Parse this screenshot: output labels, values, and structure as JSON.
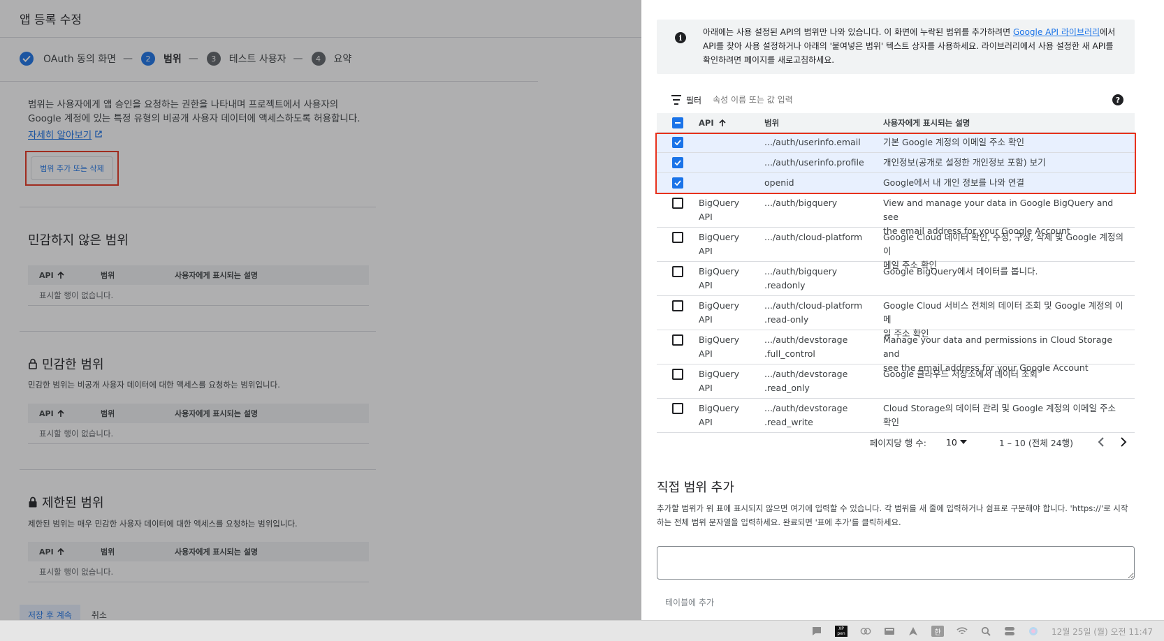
{
  "left": {
    "page_title": "앱 등록 수정",
    "stepper": [
      {
        "label": "OAuth 동의 화면",
        "state": "done"
      },
      {
        "num": "2",
        "label": "범위",
        "state": "active"
      },
      {
        "num": "3",
        "label": "테스트 사용자",
        "state": "pending"
      },
      {
        "num": "4",
        "label": "요약",
        "state": "pending"
      }
    ],
    "step_separator": "—",
    "intro_line1": "범위는 사용자에게 앱 승인을 요청하는 권한을 나타내며 프로젝트에서 사용자의",
    "intro_line2": "Google 계정에 있는 특정 유형의 비공개 사용자 데이터에 액세스하도록 허용합니다.",
    "learn_more": "자세히 알아보기",
    "scope_button": "범위 추가 또는 삭제",
    "table_headers": {
      "api": "API",
      "scope": "범위",
      "desc": "사용자에게 표시되는 설명"
    },
    "empty_text": "표시할 행이 없습니다.",
    "sections": {
      "nonsensitive": {
        "title": "민감하지 않은 범위"
      },
      "sensitive": {
        "title": "민감한 범위",
        "desc": "민감한 범위는 비공개 사용자 데이터에 대한 액세스를 요청하는 범위입니다."
      },
      "restricted": {
        "title": "제한된 범위",
        "desc": "제한된 범위는 매우 민감한 사용자 데이터에 대한 액세스를 요청하는 범위입니다."
      }
    },
    "save_button": "저장 후 계속",
    "cancel_button": "취소"
  },
  "panel": {
    "info_text_before": "아래에는 사용 설정된 API의 범위만 나와 있습니다. 이 화면에 누락된 범위를 추가하려면 ",
    "info_link": "Google API 라이브러리",
    "info_text_after": "에서 API를 찾아 사용 설정하거나 아래의 '붙여넣은 범위' 텍스트 상자를 사용하세요. 라이브러리에서 사용 설정한 새 API를 확인하려면 페이지를 새로고침하세요.",
    "filter_label": "필터",
    "filter_placeholder": "속성 이름 또는 값 입력",
    "headers": {
      "api": "API",
      "scope": "범위",
      "desc": "사용자에게 표시되는 설명"
    },
    "rows": [
      {
        "checked": true,
        "api1": "",
        "api2": "",
        "scope1": ".../auth/userinfo.email",
        "scope2": "",
        "desc1": "기본 Google 계정의 이메일 주소 확인",
        "desc2": ""
      },
      {
        "checked": true,
        "api1": "",
        "api2": "",
        "scope1": ".../auth/userinfo.profile",
        "scope2": "",
        "desc1": "개인정보(공개로 설정한 개인정보 포함) 보기",
        "desc2": ""
      },
      {
        "checked": true,
        "api1": "",
        "api2": "",
        "scope1": "openid",
        "scope2": "",
        "desc1": "Google에서 내 개인 정보를 나와 연결",
        "desc2": ""
      },
      {
        "checked": false,
        "api1": "BigQuery",
        "api2": "API",
        "scope1": ".../auth/bigquery",
        "scope2": "",
        "desc1": "View and manage your data in Google BigQuery and see",
        "desc2": "the email address for your Google Account"
      },
      {
        "checked": false,
        "api1": "BigQuery",
        "api2": "API",
        "scope1": ".../auth/cloud-platform",
        "scope2": "",
        "desc1": "Google Cloud 데이터 확인, 수정, 구성, 삭제 및 Google 계정의 이",
        "desc2": "메일 주소 확인"
      },
      {
        "checked": false,
        "api1": "BigQuery",
        "api2": "API",
        "scope1": ".../auth/bigquery",
        "scope2": ".readonly",
        "desc1": "Google BigQuery에서 데이터를 봅니다.",
        "desc2": ""
      },
      {
        "checked": false,
        "api1": "BigQuery",
        "api2": "API",
        "scope1": ".../auth/cloud-platform",
        "scope2": ".read-only",
        "desc1": "Google Cloud 서비스 전체의 데이터 조회 및 Google 계정의 이메",
        "desc2": "일 주소 확인"
      },
      {
        "checked": false,
        "api1": "BigQuery",
        "api2": "API",
        "scope1": ".../auth/devstorage",
        "scope2": ".full_control",
        "desc1": "Manage your data and permissions in Cloud Storage and",
        "desc2": "see the email address for your Google Account"
      },
      {
        "checked": false,
        "api1": "BigQuery",
        "api2": "API",
        "scope1": ".../auth/devstorage",
        "scope2": ".read_only",
        "desc1": "Google 클라우드 저장소에서 데이터 조회",
        "desc2": ""
      },
      {
        "checked": false,
        "api1": "BigQuery",
        "api2": "API",
        "scope1": ".../auth/devstorage",
        "scope2": ".read_write",
        "desc1": "Cloud Storage의 데이터 관리 및 Google 계정의 이메일 주소 확인",
        "desc2": ""
      }
    ],
    "pager": {
      "rows_per_page_label": "페이지당 행 수:",
      "rows_per_page": "10",
      "range": "1 – 10 (전체 24행)"
    },
    "manual_title": "직접 범위 추가",
    "manual_desc": "추가할 범위가 위 표에 표시되지 않으면 여기에 입력할 수 있습니다. 각 범위를 새 줄에 입력하거나 쉼표로 구분해야 합니다. 'https://'로 시작하는 전체 범위 문자열을 입력하세요. 완료되면 '표에 추가'를 클릭하세요.",
    "add_to_table": "테이블에 추가"
  },
  "taskbar": {
    "xpen_line1": "XP",
    "xpen_line2": "pen",
    "ime": "한",
    "clock": "12월 25일 (월) 오전 11:47"
  },
  "colors": {
    "accent": "#1a73e8",
    "highlight": "#e8321d"
  }
}
